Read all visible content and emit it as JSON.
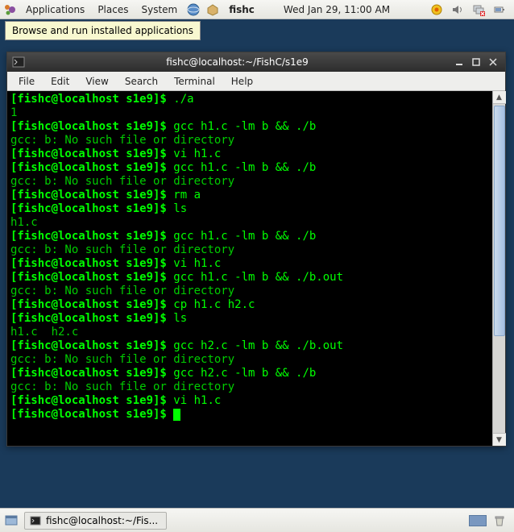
{
  "panel": {
    "applications": "Applications",
    "places": "Places",
    "system": "System",
    "fishc": "fishc",
    "clock": "Wed Jan 29, 11:00 AM",
    "tooltip": "Browse and run installed applications"
  },
  "window": {
    "title": "fishc@localhost:~/FishC/s1e9",
    "menus": {
      "file": "File",
      "edit": "Edit",
      "view": "View",
      "search": "Search",
      "terminal": "Terminal",
      "help": "Help"
    }
  },
  "terminal": {
    "prompt": "[fishc@localhost s1e9]$ ",
    "lines": [
      {
        "t": "pc",
        "cmd": "./a"
      },
      {
        "t": "o",
        "text": "1"
      },
      {
        "t": "pc",
        "cmd": "gcc h1.c -lm b && ./b"
      },
      {
        "t": "o",
        "text": "gcc: b: No such file or directory"
      },
      {
        "t": "pc",
        "cmd": "vi h1.c"
      },
      {
        "t": "pc",
        "cmd": "gcc h1.c -lm b && ./b"
      },
      {
        "t": "o",
        "text": "gcc: b: No such file or directory"
      },
      {
        "t": "pc",
        "cmd": "rm a"
      },
      {
        "t": "pc",
        "cmd": "ls"
      },
      {
        "t": "o",
        "text": "h1.c"
      },
      {
        "t": "pc",
        "cmd": "gcc h1.c -lm b && ./b"
      },
      {
        "t": "o",
        "text": "gcc: b: No such file or directory"
      },
      {
        "t": "pc",
        "cmd": "vi h1.c"
      },
      {
        "t": "pc",
        "cmd": "gcc h1.c -lm b && ./b.out"
      },
      {
        "t": "o",
        "text": "gcc: b: No such file or directory"
      },
      {
        "t": "pc",
        "cmd": "cp h1.c h2.c"
      },
      {
        "t": "pc",
        "cmd": "ls"
      },
      {
        "t": "o",
        "text": "h1.c  h2.c"
      },
      {
        "t": "pc",
        "cmd": "gcc h2.c -lm b && ./b.out"
      },
      {
        "t": "o",
        "text": "gcc: b: No such file or directory"
      },
      {
        "t": "pc",
        "cmd": "gcc h2.c -lm b && ./b"
      },
      {
        "t": "o",
        "text": "gcc: b: No such file or directory"
      },
      {
        "t": "pc",
        "cmd": "vi h1.c"
      },
      {
        "t": "cursor"
      }
    ]
  },
  "taskbar": {
    "task0": "fishc@localhost:~/Fis..."
  }
}
